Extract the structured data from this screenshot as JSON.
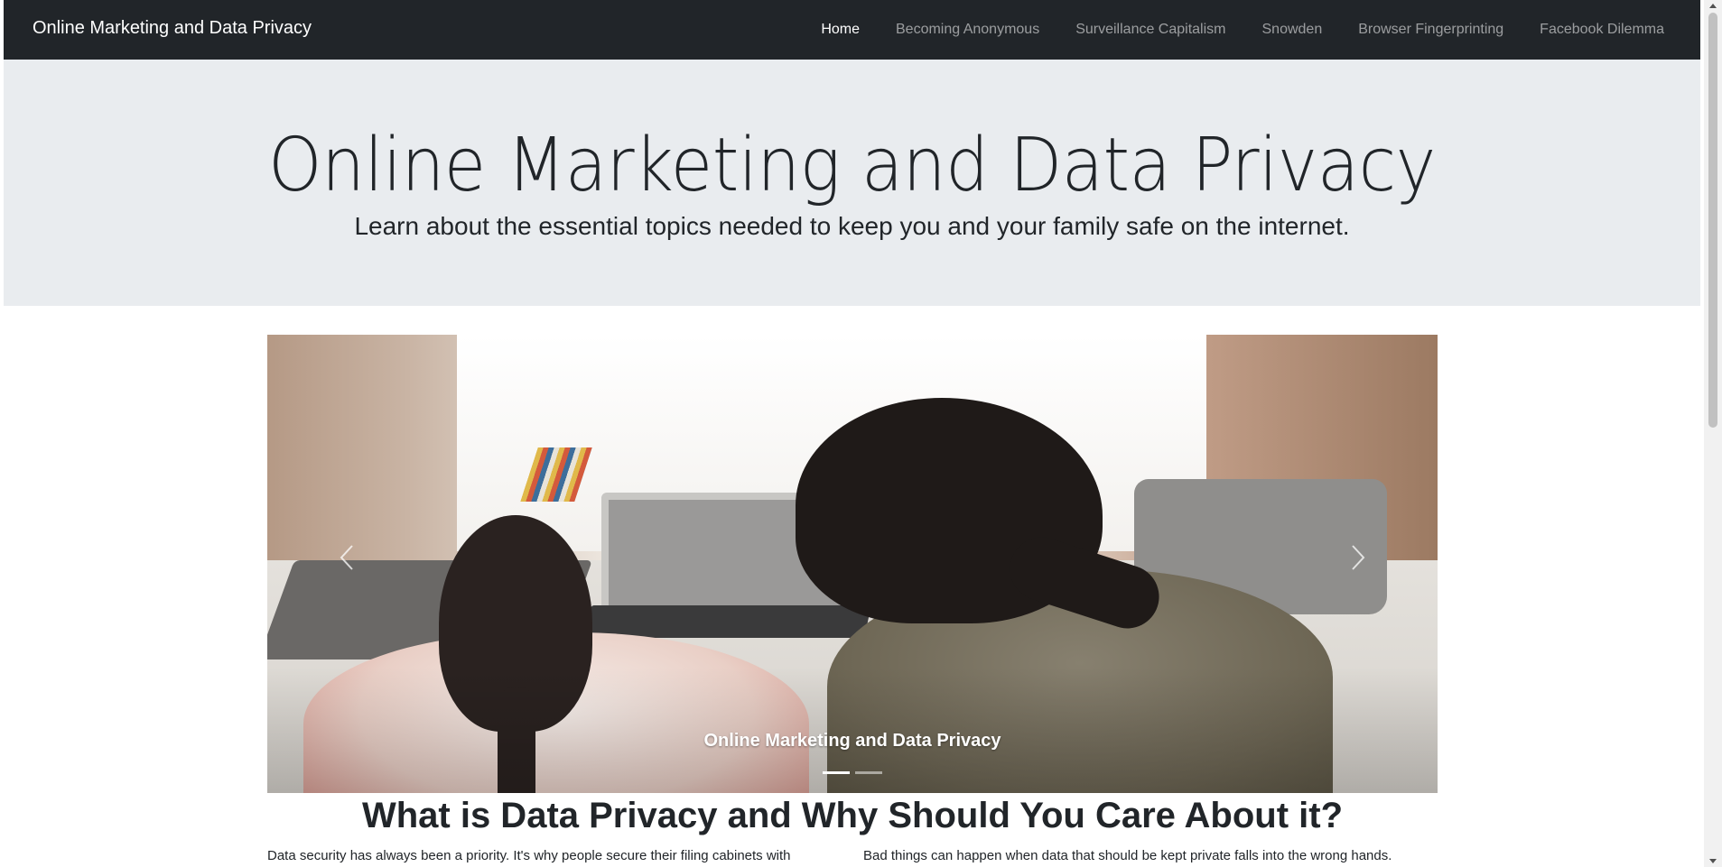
{
  "navbar": {
    "brand": "Online Marketing and Data Privacy",
    "links": [
      {
        "label": "Home",
        "active": true
      },
      {
        "label": "Becoming Anonymous",
        "active": false
      },
      {
        "label": "Surveillance Capitalism",
        "active": false
      },
      {
        "label": "Snowden",
        "active": false
      },
      {
        "label": "Browser Fingerprinting",
        "active": false
      },
      {
        "label": "Facebook Dilemma",
        "active": false
      }
    ]
  },
  "hero": {
    "title": "Online Marketing and Data Privacy",
    "subtitle": "Learn about the essential topics needed to keep you and your family safe on the internet."
  },
  "carousel": {
    "caption": "Online Marketing and Data Privacy",
    "slide_count": 2,
    "active_slide": 1,
    "prev_icon": "chevron-left-icon",
    "next_icon": "chevron-right-icon"
  },
  "section": {
    "title": "What is Data Privacy and Why Should You Care About it?",
    "left_text": "Data security has always been a priority. It's why people secure their filing cabinets with",
    "right_text": "Bad things can happen when data that should be kept private falls into the wrong hands."
  },
  "colors": {
    "navbar_bg": "#212529",
    "hero_bg": "#e9ecef",
    "text": "#212529"
  }
}
